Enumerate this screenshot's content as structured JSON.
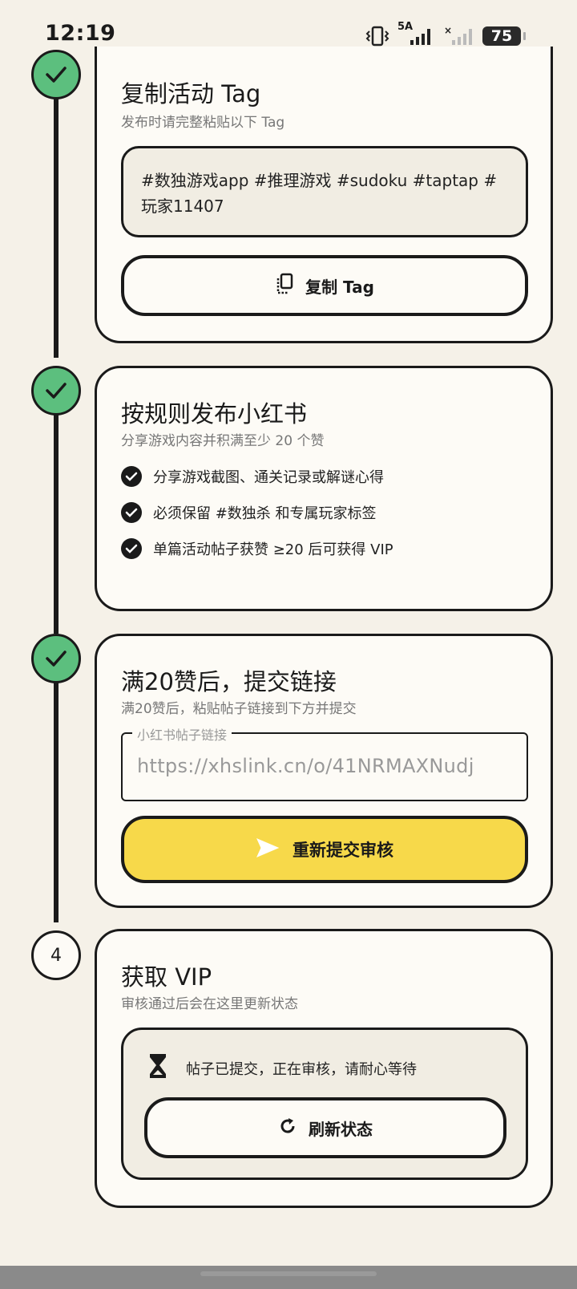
{
  "status_bar": {
    "time": "12:19",
    "network_label": "5A",
    "battery": "75",
    "icons": [
      "vibrate-icon",
      "signal-icon",
      "signal-off-icon",
      "battery-icon"
    ]
  },
  "steps": [
    {
      "state": "done",
      "title": "复制活动 Tag",
      "subtitle": "发布时请完整粘贴以下 Tag",
      "tag_text": "#数独游戏app #推理游戏 #sudoku #taptap #玩家11407",
      "button_label": "复制 Tag",
      "button_icon": "copy-icon"
    },
    {
      "state": "done",
      "title": "按规则发布小红书",
      "subtitle": "分享游戏内容并积满至少 20 个赞",
      "rules": [
        "分享游戏截图、通关记录或解谜心得",
        "必须保留 #数独杀 和专属玩家标签",
        "单篇活动帖子获赞 ≥20 后可获得 VIP"
      ]
    },
    {
      "state": "done",
      "title": "满20赞后，提交链接",
      "subtitle": "满20赞后，粘贴帖子链接到下方并提交",
      "field_label": "小红书帖子链接",
      "field_value": "https://xhslink.cn/o/41NRMAXNudj",
      "button_label": "重新提交审核",
      "button_icon": "send-icon"
    },
    {
      "state": "pending",
      "number": "4",
      "title": "获取 VIP",
      "subtitle": "审核通过后会在这里更新状态",
      "status_text": "帖子已提交，正在审核，请耐心等待",
      "status_icon": "hourglass-icon",
      "button_label": "刷新状态",
      "button_icon": "refresh-icon"
    }
  ],
  "colors": {
    "background": "#f5f1e8",
    "card": "#fdfbf6",
    "done_green": "#5cbf7e",
    "primary_yellow": "#f7d94a",
    "ink": "#1a1a1a"
  }
}
